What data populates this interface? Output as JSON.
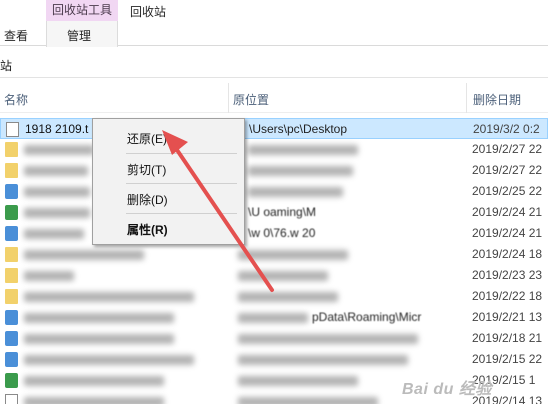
{
  "ribbon": {
    "context_group": "回收站工具",
    "tab_view": "查看",
    "tab_manage": "管理",
    "tab_recycle_bin": "回收站"
  },
  "address": {
    "path": "站"
  },
  "columns": {
    "name": "名称",
    "original_location": "原位置",
    "date_deleted": "删除日期"
  },
  "rows": [
    {
      "name": "1918 2109.t",
      "location": "\\Users\\pc\\Desktop",
      "date": "2019/3/2 0:2",
      "icon": "text-file-icon",
      "selected": true
    },
    {
      "name": "",
      "location": "",
      "date": "2019/2/27 22",
      "icon": "folder-icon"
    },
    {
      "name": "",
      "location": "",
      "date": "2019/2/27 22",
      "icon": "folder-icon"
    },
    {
      "name": "",
      "location": "",
      "date": "2019/2/25 22",
      "icon": "app-icon"
    },
    {
      "name": "",
      "location": "\\U oaming\\M",
      "date": "2019/2/24 21",
      "icon": "app-icon"
    },
    {
      "name": "",
      "location": "\\w 0\\76.w 20",
      "date": "2019/2/24 21",
      "icon": "app-icon"
    },
    {
      "name": "",
      "location": "",
      "date": "2019/2/24 18",
      "icon": "folder-icon"
    },
    {
      "name": "",
      "location": "",
      "date": "2019/2/23 23",
      "icon": "folder-icon"
    },
    {
      "name": "",
      "location": "",
      "date": "2019/2/22 18",
      "icon": "folder-icon"
    },
    {
      "name": "",
      "location": "pData\\Roaming\\Micr",
      "date": "2019/2/21 13",
      "icon": "app-icon"
    },
    {
      "name": "",
      "location": "",
      "date": "2019/2/18 21",
      "icon": "app-icon"
    },
    {
      "name": "",
      "location": "",
      "date": "2019/2/15 22",
      "icon": "app-icon"
    },
    {
      "name": "",
      "location": "",
      "date": "2019/2/15 1",
      "icon": "app-icon"
    },
    {
      "name": "",
      "location": "",
      "date": "2019/2/14 13",
      "icon": "text-file-icon"
    }
  ],
  "context_menu": {
    "restore": "还原(E)",
    "cut": "剪切(T)",
    "delete": "删除(D)",
    "properties": "属性(R)"
  },
  "colors": {
    "selection": "#cce8ff",
    "context_tab": "#f1d7f3",
    "arrow": "#e4504f"
  },
  "watermark": "Bai du 经验"
}
